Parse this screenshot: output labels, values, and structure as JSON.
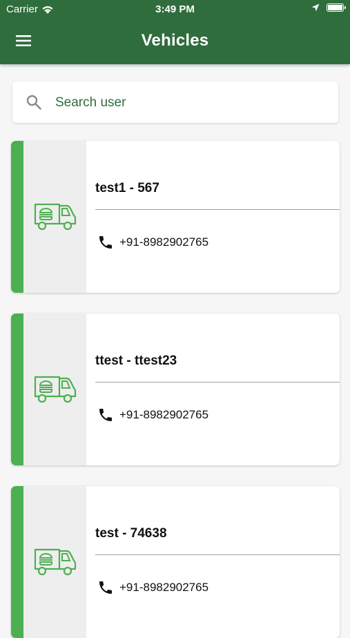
{
  "status_bar": {
    "carrier": "Carrier",
    "time": "3:49 PM"
  },
  "header": {
    "title": "Vehicles",
    "background_color": "#2f6d3c",
    "menu_icon": "hamburger-menu-icon"
  },
  "search": {
    "placeholder": "Search user",
    "value": "",
    "icon": "search-icon"
  },
  "vehicles": [
    {
      "title": "test1 - 567",
      "phone": "+91-8982902765"
    },
    {
      "title": "ttest - ttest23",
      "phone": "+91-8982902765"
    },
    {
      "title": "test - 74638",
      "phone": "+91-8982902765"
    }
  ],
  "colors": {
    "accent": "#4caf50",
    "header": "#2f6d3c",
    "icon_panel": "#eeeeee"
  },
  "icons": {
    "vehicle": "food-truck-icon",
    "phone": "phone-icon"
  }
}
